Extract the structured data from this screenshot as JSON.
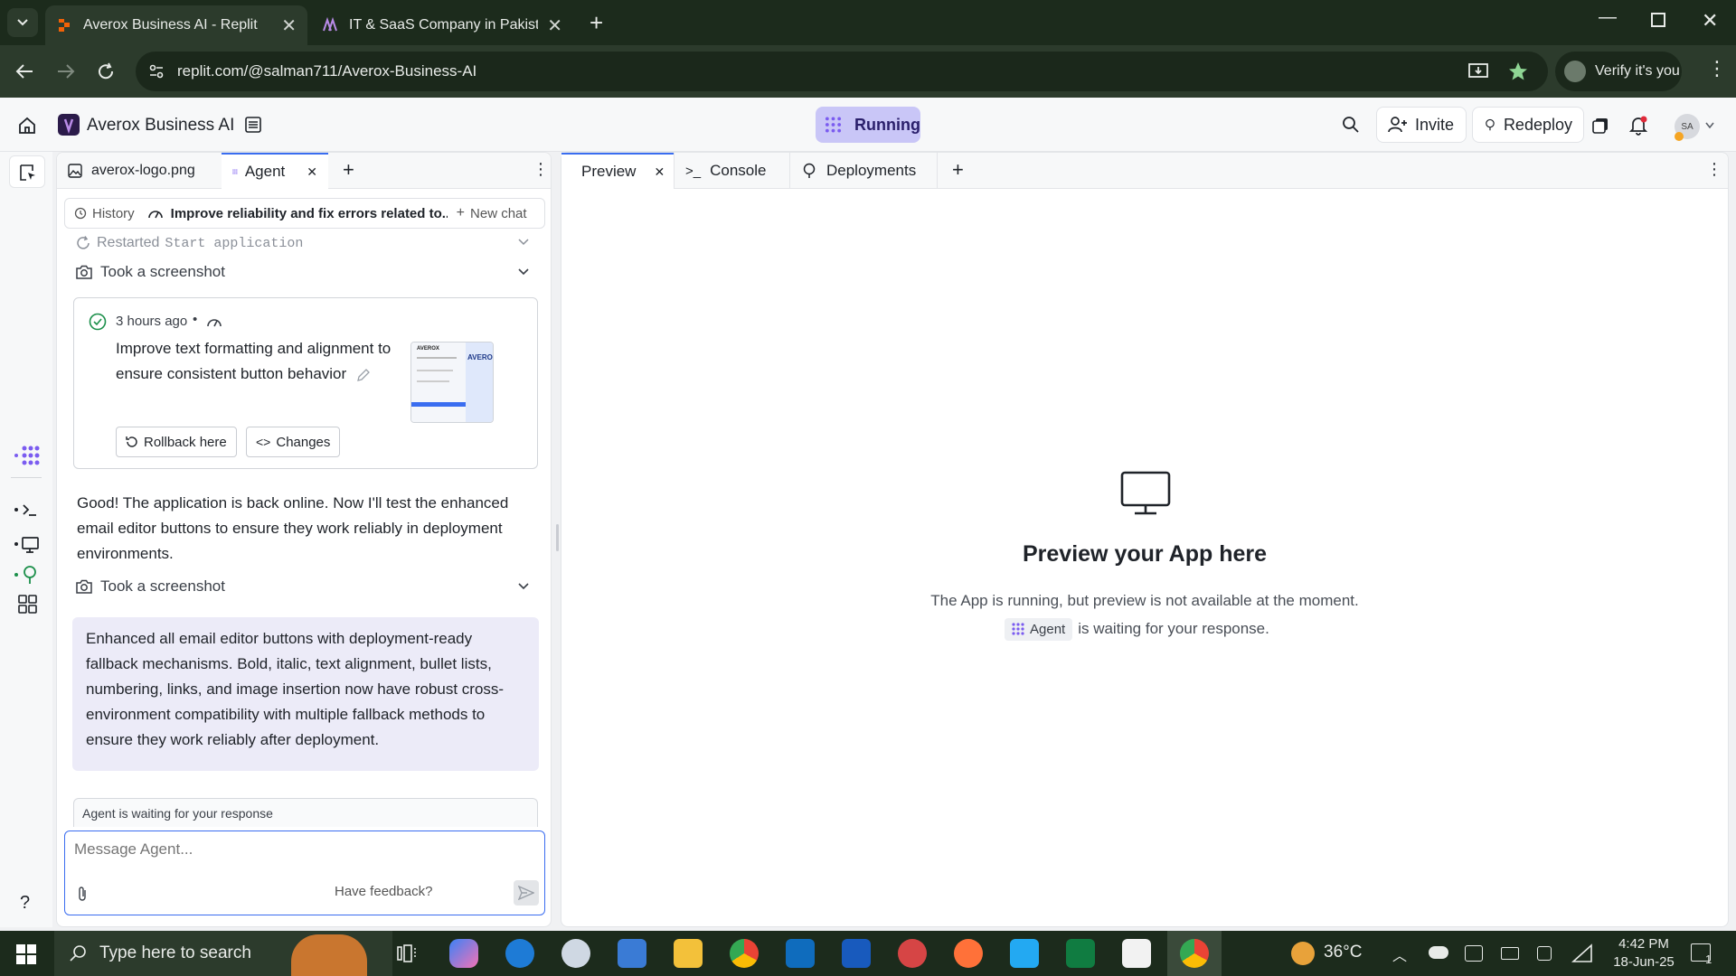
{
  "browser": {
    "tabs": [
      {
        "title": "Averox Business AI - Replit",
        "active": true
      },
      {
        "title": "IT & SaaS Company in Pakistan",
        "active": false
      }
    ],
    "url": "replit.com/@salman711/Averox-Business-AI",
    "verify_label": "Verify it's you"
  },
  "app": {
    "project_name": "Averox Business AI",
    "status": "Running",
    "invite_label": "Invite",
    "redeploy_label": "Redeploy",
    "avatar_initials": "SA"
  },
  "left_tabs": [
    {
      "label": "averox-logo.png"
    },
    {
      "label": "Agent"
    }
  ],
  "chat": {
    "history_label": "History",
    "thread_title": "Improve reliability and fix errors related to...",
    "new_chat_label": "New chat",
    "restarted_label": "Restarted",
    "restarted_code": "Start application",
    "screenshot_label": "Took a screenshot",
    "checkpoint": {
      "time": "3 hours ago",
      "title": "Improve text formatting and alignment to ensure consistent button behavior",
      "rollback_label": "Rollback here",
      "changes_label": "Changes",
      "thumb_logo": "AVEROX"
    },
    "message1": "Good! The application is back online. Now I'll test the enhanced email editor buttons to ensure they work reliably in deployment environments.",
    "screenshot_label2": "Took a screenshot",
    "summary": "Enhanced all email editor buttons with deployment-ready fallback mechanisms. Bold, italic, text alignment, bullet lists, numbering, links, and image insertion now have robust cross-environment compatibility with multiple fallback methods to ensure they work reliably after deployment.",
    "waiting_banner": "Agent is waiting for your response",
    "input_placeholder": "Message Agent...",
    "feedback_label": "Have feedback?"
  },
  "right_tabs": [
    {
      "label": "Preview"
    },
    {
      "label": "Console"
    },
    {
      "label": "Deployments"
    }
  ],
  "preview": {
    "heading": "Preview your App here",
    "line1": "The App is running, but preview is not available at the moment.",
    "agent_chip": "Agent",
    "line2": "is waiting for your response."
  },
  "taskbar": {
    "search_placeholder": "Type here to search",
    "temperature": "36°C",
    "time": "4:42 PM",
    "date": "18-Jun-25",
    "notification_count": "1"
  },
  "colors": {
    "accent_purple": "#7b5cf0",
    "running_bg": "#c9c6f7",
    "taskbar": "#1c2b1c",
    "summary_bg": "#ecebf8"
  }
}
